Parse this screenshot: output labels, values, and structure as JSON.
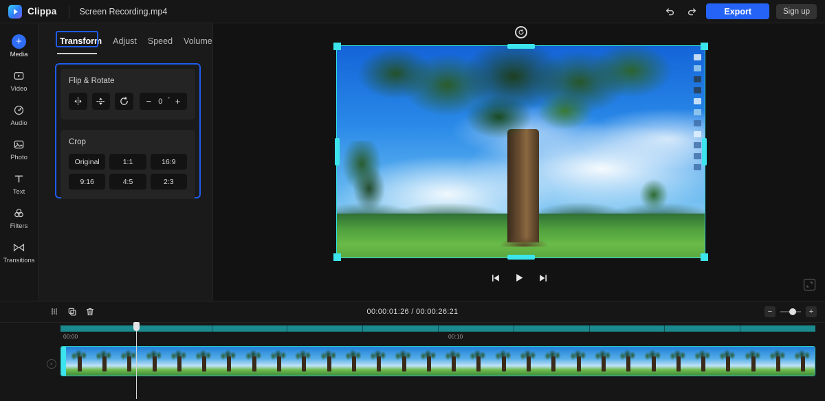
{
  "app": {
    "brand": "Clippa",
    "filename": "Screen Recording.mp4",
    "logo_icon": "play-logo-icon"
  },
  "topbar": {
    "undo_icon": "undo-icon",
    "redo_icon": "redo-icon",
    "export_label": "Export",
    "signup_label": "Sign up"
  },
  "sidebar": {
    "items": [
      {
        "label": "Media",
        "icon": "plus-circle-icon",
        "active": true
      },
      {
        "label": "Video",
        "icon": "video-icon",
        "active": false
      },
      {
        "label": "Audio",
        "icon": "audio-icon",
        "active": false
      },
      {
        "label": "Photo",
        "icon": "photo-icon",
        "active": false
      },
      {
        "label": "Text",
        "icon": "text-icon",
        "active": false
      },
      {
        "label": "Filters",
        "icon": "filters-icon",
        "active": false
      },
      {
        "label": "Transitions",
        "icon": "transitions-icon",
        "active": false
      }
    ]
  },
  "properties": {
    "tabs": [
      {
        "label": "Transform",
        "active": true
      },
      {
        "label": "Adjust",
        "active": false
      },
      {
        "label": "Speed",
        "active": false
      },
      {
        "label": "Volume",
        "active": false
      }
    ],
    "flip_rotate": {
      "title": "Flip & Rotate",
      "flip_horizontal_icon": "flip-horizontal-icon",
      "flip_vertical_icon": "flip-vertical-icon",
      "rotate_icon": "rotate-icon",
      "decrease_label": "−",
      "increase_label": "+",
      "angle_value": "0",
      "angle_unit": "°"
    },
    "crop": {
      "title": "Crop",
      "ratios": [
        "Original",
        "1:1",
        "16:9",
        "9:16",
        "4:5",
        "2:3"
      ]
    }
  },
  "preview": {
    "rotate_handle_icon": "rotate-handle-icon",
    "prev_frame_icon": "previous-frame-icon",
    "play_icon": "play-icon",
    "next_frame_icon": "next-frame-icon",
    "fullscreen_icon": "fullscreen-icon"
  },
  "timeline": {
    "split_icon": "split-icon",
    "duplicate_icon": "duplicate-icon",
    "delete_icon": "delete-icon",
    "current_time": "00:00:01:26",
    "total_time": "00:00:26:21",
    "time_display": "00:00:01:26 / 00:00:26:21",
    "zoom_out_label": "−",
    "zoom_in_label": "+",
    "ruler_labels": [
      "00:00",
      "00:10"
    ],
    "track_icon": "video-track-icon",
    "clip_thumbnail_count": 30
  },
  "colors": {
    "accent_blue": "#2563f7",
    "highlight_blue": "#1f5cf0",
    "selection_cyan": "#3ce4ec",
    "ruler_teal": "#1a8a8f",
    "panel_bg": "#1a1a1a",
    "app_bg": "#141414"
  }
}
